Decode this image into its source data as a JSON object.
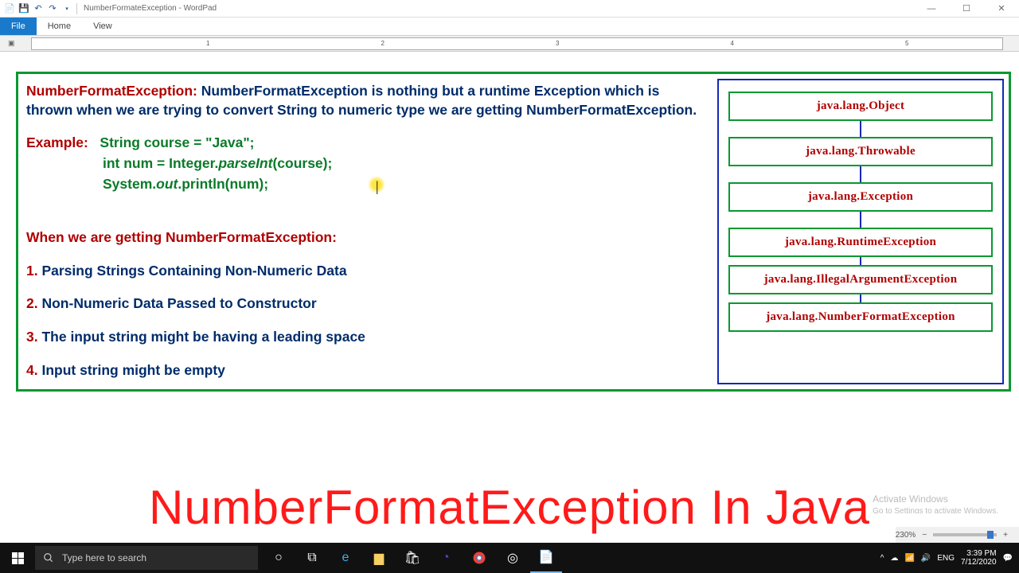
{
  "titlebar": {
    "doc_name": "NumberFormateException",
    "app_name": "WordPad"
  },
  "menu": {
    "file": "File",
    "home": "Home",
    "view": "View"
  },
  "ruler_marks": [
    "1",
    "2",
    "3",
    "4",
    "5"
  ],
  "content": {
    "heading_label": "NumberFormatException:",
    "heading_text": " NumberFormatException is nothing but a runtime Exception which is thrown when we are trying to convert String to numeric type we are getting NumberFormatException.",
    "example_label": "Example:",
    "code1": "String course = \"Java\";",
    "code2_a": "int num = Integer.",
    "code2_b": "parseInt",
    "code2_c": "(course);",
    "code3_a": "System.",
    "code3_b": "out",
    "code3_c": ".println(num);",
    "when_heading": "When we are getting NumberFormatException:",
    "pt1_num": "1.",
    "pt1": " Parsing Strings Containing Non-Numeric Data",
    "pt2_num": "2.",
    "pt2": " Non-Numeric Data Passed to Constructor",
    "pt3_num": "3.",
    "pt3": " The input string might be having a leading space",
    "pt4_num": "4.",
    "pt4": " Input string might be empty"
  },
  "hierarchy": [
    "java.lang.Object",
    "java.lang.Throwable",
    "java.lang.Exception",
    "java.lang.RuntimeException",
    "java.lang.IllegalArgumentException",
    "java.lang.NumberFormatException"
  ],
  "overlay": "NumberFormatException In Java",
  "watermark": {
    "l1": "Activate Windows",
    "l2": "Go to Settings to activate Windows."
  },
  "wp_status": {
    "zoom": "230%"
  },
  "taskbar": {
    "search_placeholder": "Type here to search",
    "lang": "ENG",
    "time": "3:39 PM",
    "date": "7/12/2020"
  }
}
